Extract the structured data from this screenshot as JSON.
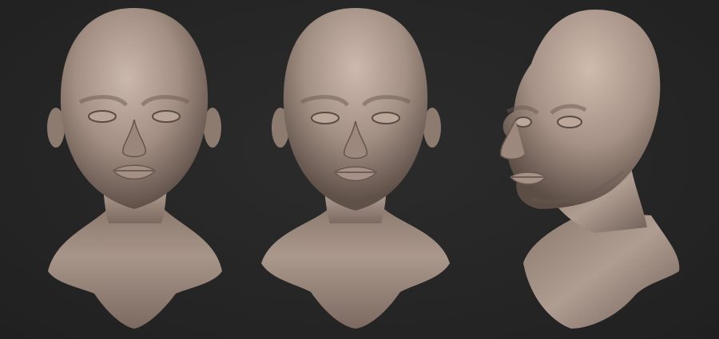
{
  "scene": {
    "background_color": "#262626",
    "clay_color": "#a08c80",
    "clay_highlight": "#c9b6aa",
    "clay_shadow": "#5e4f47",
    "views": [
      {
        "id": "front-left",
        "kind": "front"
      },
      {
        "id": "front-center",
        "kind": "front"
      },
      {
        "id": "three-quarter-right",
        "kind": "three-quarter"
      }
    ]
  }
}
